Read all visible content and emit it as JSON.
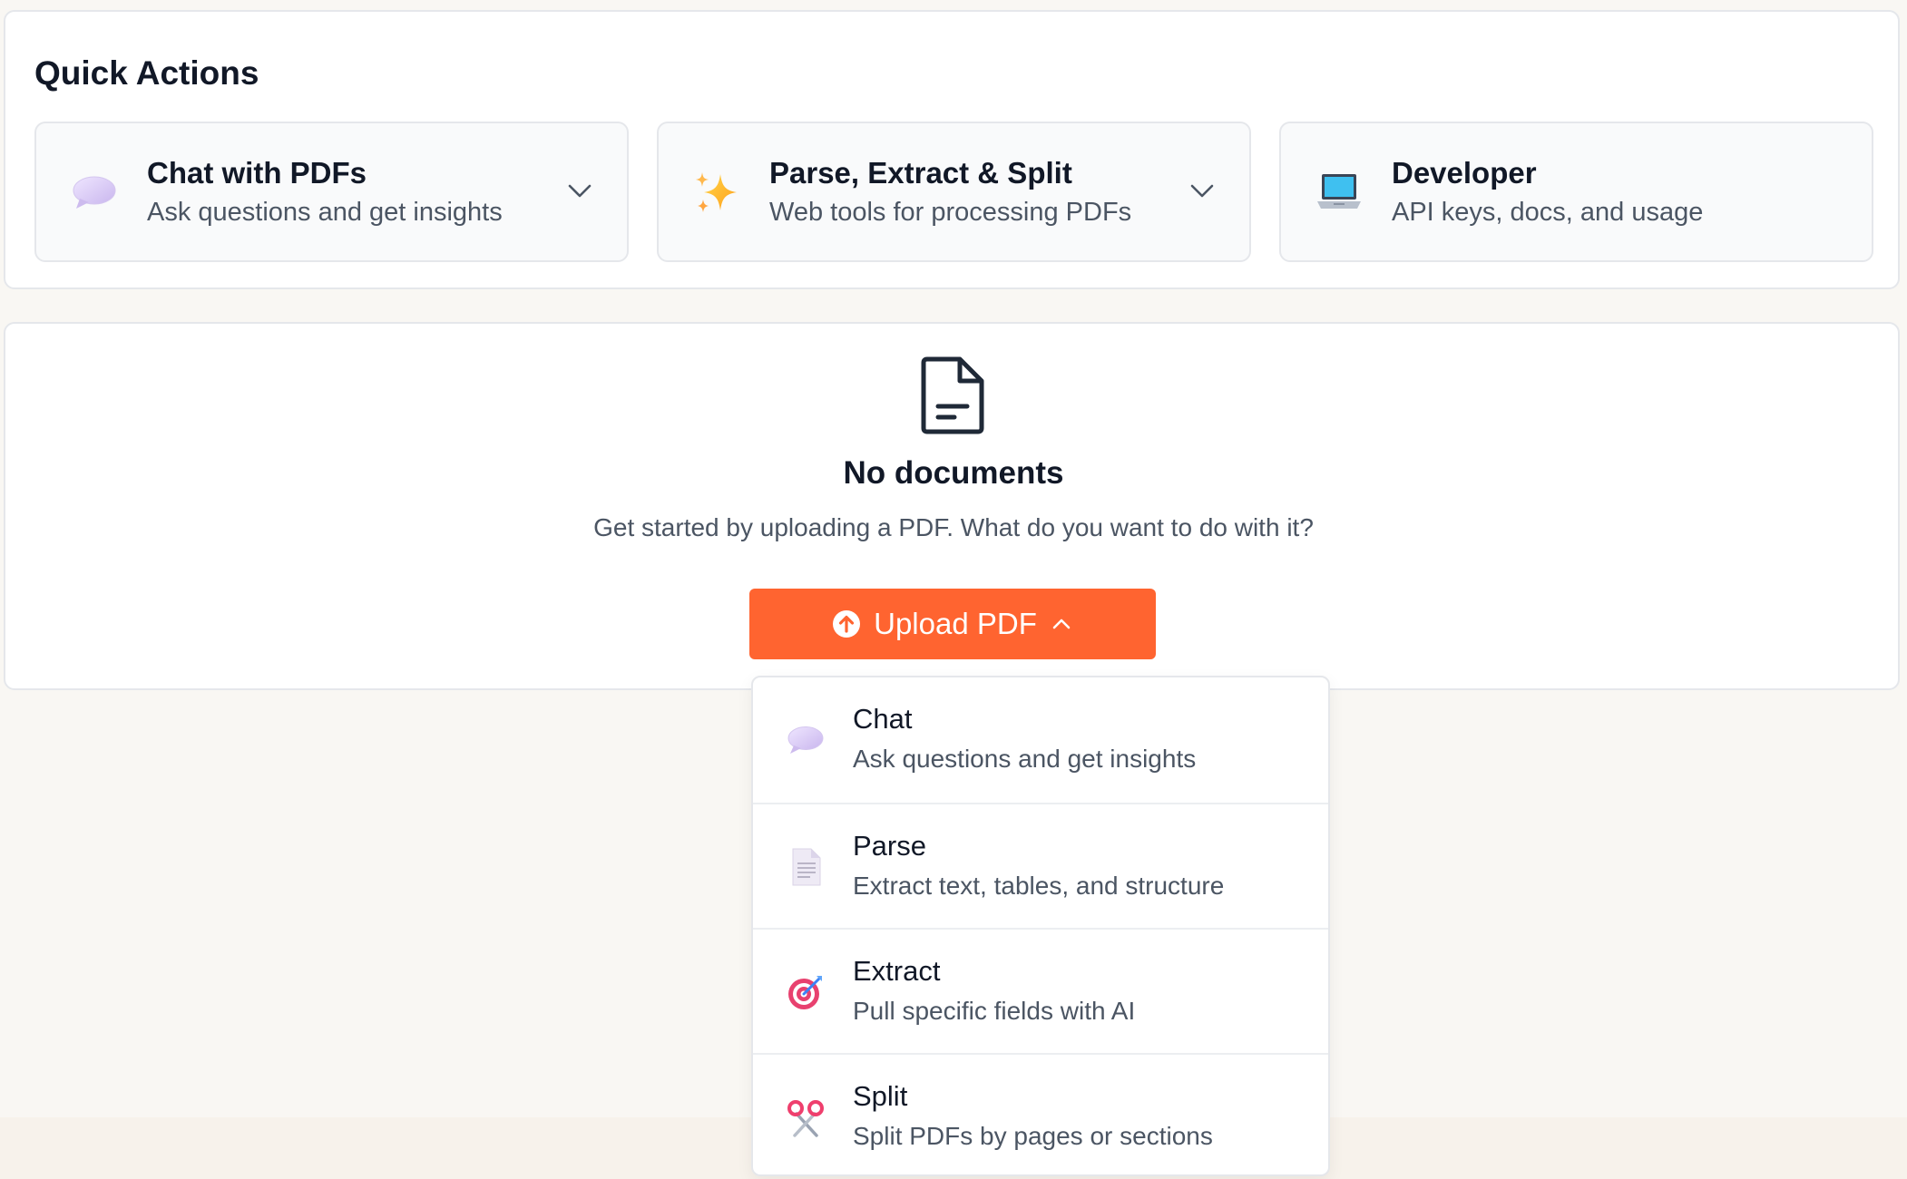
{
  "quick_actions": {
    "title": "Quick Actions",
    "cards": [
      {
        "title": "Chat with PDFs",
        "subtitle": "Ask questions and get insights",
        "icon": "speech-bubble-icon"
      },
      {
        "title": "Parse, Extract & Split",
        "subtitle": "Web tools for processing PDFs",
        "icon": "sparkles-icon"
      },
      {
        "title": "Developer",
        "subtitle": "API keys, docs, and usage",
        "icon": "laptop-icon"
      }
    ]
  },
  "empty_state": {
    "title": "No documents",
    "subtitle": "Get started by uploading a PDF. What do you want to do with it?",
    "icon": "document-icon"
  },
  "upload_button": {
    "label": "Upload PDF",
    "icon": "upload-circle-icon",
    "accent": "#ff6430"
  },
  "upload_menu": {
    "items": [
      {
        "title": "Chat",
        "subtitle": "Ask questions and get insights",
        "icon": "speech-bubble-icon"
      },
      {
        "title": "Parse",
        "subtitle": "Extract text, tables, and structure",
        "icon": "page-icon"
      },
      {
        "title": "Extract",
        "subtitle": "Pull specific fields with AI",
        "icon": "target-icon"
      },
      {
        "title": "Split",
        "subtitle": "Split PDFs by pages or sections",
        "icon": "scissors-icon"
      }
    ]
  }
}
